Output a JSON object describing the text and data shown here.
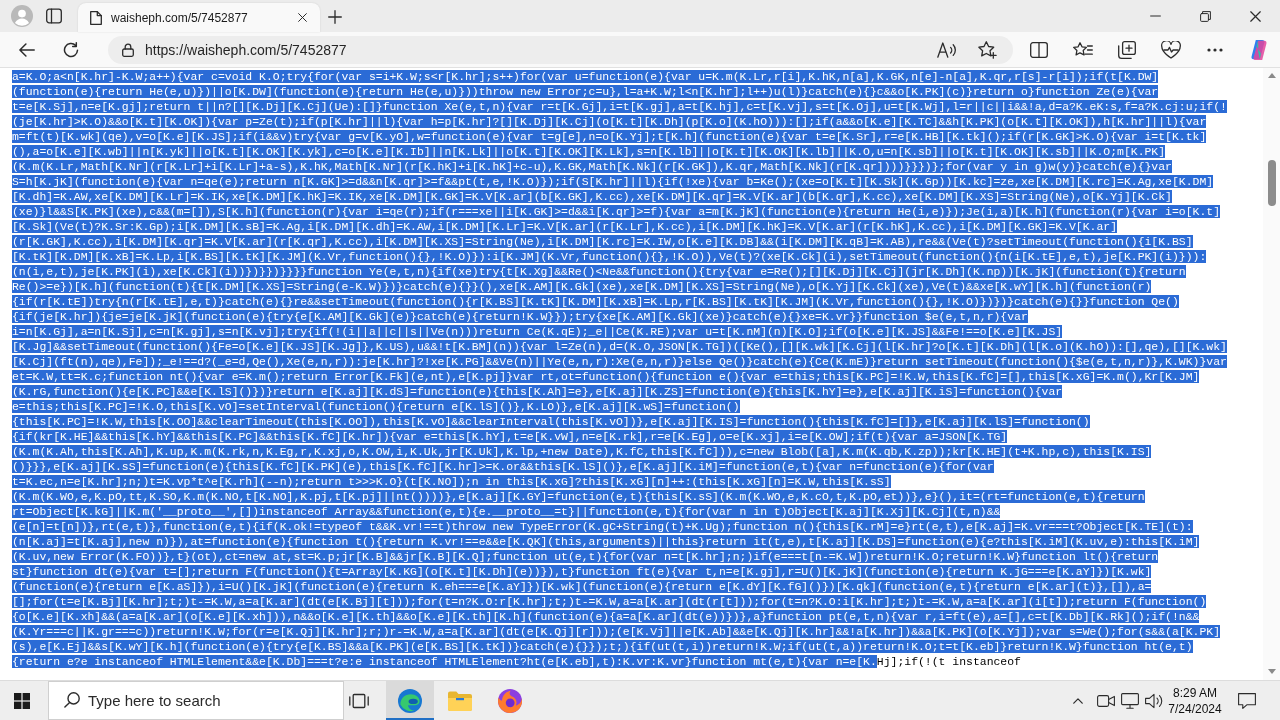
{
  "browser": {
    "tabs": [
      {
        "title": "waisheph.com/5/7452877",
        "selected": true
      }
    ],
    "address_bar": {
      "url": "https://waisheph.com/5/7452877"
    }
  },
  "page": {
    "lines": [
      {
        "text": "a=K.O;a<n[K.hr]-K.W;a++){var c=void K.O;try{for(var s=i+K.W;s<r[K.hr];s++)for(var u=function(e){var u=K.m(K.Lr,r[i],K.hK,n[a],K.GK,n[e]-n[a],K.qr,r[s]-r[i]);if(t[K.DW]",
        "selected": true
      },
      {
        "text": "(function(e){return He(e,u)})||o[K.DW](function(e){return He(e,u)}))throw new Error;c=u},l=a+K.W;l<n[K.hr];l++)u(l)}catch(e){}c&&o[K.PK](c)}return o}function Ze(e){var",
        "selected": true
      },
      {
        "text": "t=e[K.Sj],n=e[K.gj];return t||n?[][K.Dj][K.Cj](Ue):[]}function Xe(e,t,n){var r=t[K.Gj],i=t[K.gj],a=t[K.hj],c=t[K.vj],s=t[K.Oj],u=t[K.Wj],l=r||c||i&&!a,d=a?K.eK:s,f=a?K.cj:u;if(!",
        "selected": true
      },
      {
        "text": "(je[K.hr]>K.O)&&o[K.t][K.OK]){var p=Ze(t);if(p[K.hr]||l){var h=p[K.hr]?[][K.Dj][K.Cj](o[K.t][K.Dh](p[K.o](K.hO))):[];if(a&&o[K.e][K.TC]&&h[K.PK](o[K.t][K.OK]),h[K.hr]||l){var",
        "selected": true
      },
      {
        "text": "m=ft(t)[K.wk](qe),v=o[K.e][K.JS];if(i&&v)try{var g=v[K.yO],w=function(e){var t=g[e],n=o[K.Yj];t[K.h](function(e){var t=e[K.Sr],r=e[K.HB][K.tk]();if(r[K.GK]>K.O){var i=t[K.tk]",
        "selected": true
      },
      {
        "text": "(),a=o[K.e][K.wb]||n[K.yk]||o[K.t][K.OK][K.yk],c=o[K.e][K.Ib]||n[K.Lk]||o[K.t][K.OK][K.Lk],s=n[K.lb]||o[K.t][K.OK][K.lb]||K.O,u=n[K.sb]||o[K.t][K.OK][K.sb]||K.O;m[K.PK]",
        "selected": true
      },
      {
        "text": "(K.m(K.Lr,Math[K.Nr](r[K.Lr]+i[K.Lr]+a-s),K.hK,Math[K.Nr](r[K.hK]+i[K.hK]+c-u),K.GK,Math[K.Nk](r[K.GK]),K.qr,Math[K.Nk](r[K.qr])))}}})};for(var y in g)w(y)}catch(e){}var",
        "selected": true
      },
      {
        "text": "S=h[K.jK](function(e){var n=qe(e);return n[K.GK]>=d&&n[K.qr]>=f&&pt(t,e,!K.O)});if(S[K.hr]||l){if(!xe){var b=Ke();(xe=o[K.t][K.Sk](K.Gp))[K.kc]=ze,xe[K.DM][K.rc]=K.Ag,xe[K.DM]",
        "selected": true
      },
      {
        "text": "[K.dh]=K.AW,xe[K.DM][K.Lr]=K.IK,xe[K.DM][K.hK]=K.IK,xe[K.DM][K.GK]=K.V[K.ar](b[K.GK],K.cc),xe[K.DM][K.qr]=K.V[K.ar](b[K.qr],K.cc),xe[K.DM][K.XS]=String(Ne),o[K.Yj][K.Ck]",
        "selected": true
      },
      {
        "text": "(xe)}l&&S[K.PK](xe),c&&(m=[]),S[K.h](function(r){var i=qe(r);if(r===xe||i[K.GK]>=d&&i[K.qr]>=f){var a=m[K.jK](function(e){return He(i,e)});Je(i,a)[K.h](function(r){var i=o[K.t]",
        "selected": true
      },
      {
        "text": "[K.Sk](Ve(t)?K.Sr:K.Gp);i[K.DM][K.sB]=K.Ag,i[K.DM][K.dh]=K.AW,i[K.DM][K.Lr]=K.V[K.ar](r[K.Lr],K.cc),i[K.DM][K.hK]=K.V[K.ar](r[K.hK],K.cc),i[K.DM][K.GK]=K.V[K.ar]",
        "selected": true
      },
      {
        "text": "(r[K.GK],K.cc),i[K.DM][K.qr]=K.V[K.ar](r[K.qr],K.cc),i[K.DM][K.XS]=String(Ne),i[K.DM][K.rc]=K.IW,o[K.e][K.DB]&&(i[K.DM][K.qB]=K.AB),re&&(Ve(t)?setTimeout(function(){i[K.BS]",
        "selected": true
      },
      {
        "text": "[K.tK][K.DM][K.xB]=K.Lp,i[K.BS][K.tK][K.JM](K.Vr,function(){},!K.O)}):i[K.JM](K.Vr,function(){},!K.O)),Ve(t)?(xe[K.Ck](i),setTimeout(function(){n(i[K.tE],e,t),je[K.PK](i)})):",
        "selected": true
      },
      {
        "text": "(n(i,e,t),je[K.PK](i),xe[K.Ck](i))})}})}}}}function Ye(e,t,n){if(xe)try{t[K.Xg]&&Re()<Ne&&function(){try{var e=Re();[][K.Dj][K.Cj](jr[K.Dh](K.np))[K.jK](function(t){return",
        "selected": true
      },
      {
        "text": "Re()>=e})[K.h](function(t){t[K.DM][K.XS]=String(e-K.W)})}catch(e){}}(),xe[K.AM][K.Gk](xe),xe[K.DM][K.XS]=String(Ne),o[K.Yj][K.Ck](xe),Ve(t)&&xe[K.wY][K.h](function(r)",
        "selected": true
      },
      {
        "text": "{if(r[K.tE])try{n(r[K.tE],e,t)}catch(e){}re&&setTimeout(function(){r[K.BS][K.tK][K.DM][K.xB]=K.Lp,r[K.BS][K.tK][K.JM](K.Vr,function(){},!K.O)})})}catch(e){}}function Qe()",
        "selected": true
      },
      {
        "text": "{if(je[K.hr]){je=je[K.jK](function(e){try{e[K.AM][K.Gk](e)}catch(e){return!K.W}});try{xe[K.AM][K.Gk](xe)}catch(e){}xe=K.vr}}function $e(e,t,n,r){var",
        "selected": true
      },
      {
        "text": "i=n[K.Gj],a=n[K.Sj],c=n[K.gj],s=n[K.vj];try{if(!(i||a||c||s||Ve(n)))return Ce(K.qE);_e||Ce(K.RE);var u=t[K.nM](n)[K.O];if(o[K.e][K.JS]&&Fe!==o[K.e][K.JS]",
        "selected": true
      },
      {
        "text": "[K.Jg]&&setTimeout(function(){Fe=o[K.e][K.JS][K.Jg]},K.US),u&&!t[K.BM](n)){var l=Ze(n),d=(K.O,JSON[K.TG])([Ke(),[][K.wk][K.Cj](l[K.hr]?o[K.t][K.Dh](l[K.o](K.hO)):[],qe),[][K.wk]",
        "selected": true
      },
      {
        "text": "[K.Cj](ft(n),qe),Fe]);_e!==d?(_e=d,Qe(),Xe(e,n,r)):je[K.hr]?!xe[K.PG]&&Ve(n)||Ye(e,n,r):Xe(e,n,r)}else Qe()}catch(e){Ce(K.mE)}return setTimeout(function(){$e(e,t,n,r)},K.WK)}var",
        "selected": true
      },
      {
        "text": "et=K.W,tt=K.c;function nt(){var e=K.m();return Error[K.Fk](e,nt),e[K.pj]}var rt,ot=function(){function e(){var e=this;this[K.PC]=!K.W,this[K.fC]=[],this[K.xG]=K.m(),Kr[K.JM]",
        "selected": true
      },
      {
        "text": "(K.rG,function(){e[K.PC]&&e[K.lS]()})}return e[K.aj][K.dS]=function(e){this[K.Ah]=e},e[K.aj][K.ZS]=function(e){this[K.hY]=e},e[K.aj][K.iS]=function(){var",
        "selected": true
      },
      {
        "text": "e=this;this[K.PC]=!K.O,this[K.vO]=setInterval(function(){return e[K.lS]()},K.LO)},e[K.aj][K.wS]=function()",
        "selected": true
      },
      {
        "text": "{this[K.PC]=!K.W,this[K.OO]&&clearTimeout(this[K.OO]),this[K.vO]&&clearInterval(this[K.vO])},e[K.aj][K.IS]=function(){this[K.fC]=[]},e[K.aj][K.lS]=function()",
        "selected": true
      },
      {
        "text": "{if(kr[K.HE]&&this[K.hY]&&this[K.PC]&&this[K.fC][K.hr]){var e=this[K.hY],t=e[K.vW],n=e[K.rk],r=e[K.Eg],o=e[K.xj],i=e[K.OW];if(t){var a=JSON[K.TG]",
        "selected": true
      },
      {
        "text": "(K.m(K.Ah,this[K.Ah],K.up,K.m(K.rk,n,K.Eg,r,K.xj,o,K.OW,i,K.Uk,jr[K.Uk],K.lp,+new Date),K.fC,this[K.fC])),c=new Blob([a],K.m(K.qb,K.zp));kr[K.HE](t+K.hp,c),this[K.IS]",
        "selected": true
      },
      {
        "text": "()}}},e[K.aj][K.sS]=function(e){this[K.fC][K.PK](e),this[K.fC][K.hr]>=K.or&&this[K.lS]()},e[K.aj][K.iM]=function(e,t){var n=function(e){for(var",
        "selected": true
      },
      {
        "text": "t=K.ec,n=e[K.hr];n;)t=K.vp*t^e[K.rh](--n);return t>>>K.O}(t[K.NO]);n in this[K.xG]?this[K.xG][n]++:(this[K.xG][n]=K.W,this[K.sS]",
        "selected": true
      },
      {
        "text": "(K.m(K.WO,e,K.pO,tt,K.SO,K.m(K.NO,t[K.NO],K.pj,t[K.pj]||nt())))},e[K.aj][K.GY]=function(e,t){this[K.sS](K.m(K.WO,e,K.cO,t,K.pO,et))},e}(),it=(rt=function(e,t){return",
        "selected": true
      },
      {
        "text": "rt=Object[K.kG]||K.m('__proto__',[])instanceof Array&&function(e,t){e.__proto__=t}||function(e,t){for(var n in t)Object[K.aj][K.Xj][K.Cj](t,n)&&",
        "selected": true
      },
      {
        "text": "(e[n]=t[n])},rt(e,t)},function(e,t){if(K.ok!=typeof t&&K.vr!==t)throw new TypeError(K.gC+String(t)+K.Ug);function n(){this[K.rM]=e}rt(e,t),e[K.aj]=K.vr===t?Object[K.TE](t):",
        "selected": true
      },
      {
        "text": "(n[K.aj]=t[K.aj],new n)}),at=function(e){function t(){return K.vr!==e&&e[K.QK](this,arguments)||this}return it(t,e),t[K.aj][K.DS]=function(e){e?this[K.iM](K.uv,e):this[K.iM]",
        "selected": true
      },
      {
        "text": "(K.uv,new Error(K.FO))},t}(ot),ct=new at,st=K.p;jr[K.B]&&jr[K.B][K.Q];function ut(e,t){for(var n=t[K.hr];n;)if(e===t[n-=K.W])return!K.O;return!K.W}function lt(){return",
        "selected": true
      },
      {
        "text": "st}function dt(e){var t=[];return F(function(){t=Array[K.KG](o[K.t][K.Dh](e))}),t}function ft(e){var t,n=e[K.gj],r=U()[K.jK](function(e){return K.jG===e[K.aY]})[K.wk]",
        "selected": true
      },
      {
        "text": "(function(e){return e[K.aS]}),i=U()[K.jK](function(e){return K.eh===e[K.aY]})[K.wk](function(e){return e[K.dY][K.fG]()})[K.qk](function(e,t){return e[K.ar](t)},[]),a=",
        "selected": true
      },
      {
        "text": "[];for(t=e[K.Bj][K.hr];t;)t-=K.W,a=a[K.ar](dt(e[K.Bj][t]));for(t=n?K.O:r[K.hr];t;)t-=K.W,a=a[K.ar](dt(r[t]));for(t=n?K.O:i[K.hr];t;)t-=K.W,a=a[K.ar](i[t]);return F(function()",
        "selected": true
      },
      {
        "text": "{o[K.e][K.xh]&&(a=a[K.ar](o[K.e][K.xh])),n&&o[K.e][K.th]&&o[K.e][K.th][K.h](function(e){a=a[K.ar](dt(e))})},a}function pt(e,t,n){var r,i=ft(e),a=[],c=t[K.Db][K.Rk]();if(!n&&",
        "selected": true
      },
      {
        "text": "(K.Yr===c||K.gr===c))return!K.W;for(r=e[K.Qj][K.hr];r;)r-=K.W,a=a[K.ar](dt(e[K.Qj][r]));(e[K.Vj]||e[K.Ab]&&e[K.Qj][K.hr]&&!a[K.hr])&&a[K.PK](o[K.Yj]);var s=We();for(s&&(a[K.PK]",
        "selected": true
      },
      {
        "text": "(s),e[K.Ej]&&s[K.wY][K.h](function(e){try{e[K.BS]&&a[K.PK](e[K.BS][K.tK])}catch(e){}});t;){if(ut(t,i))return!K.W;if(ut(t,a))return!K.O;t=t[K.eb]}return!K.W}function ht(e,t)",
        "selected": true
      },
      {
        "segments": [
          {
            "text": "{return e?e instanceof HTMLElement&&e[K.Db]===t?e:e instanceof HTMLElement?ht(e[K.eb],t):K.vr:K.vr}function mt(e,t){var n=e[K.",
            "selected": true
          },
          {
            "text": "Hj];if(!(t instanceof",
            "selected": false
          }
        ]
      }
    ]
  },
  "taskbar": {
    "search": {
      "placeholder": "Type here to search"
    },
    "apps": [
      {
        "kind": "wave",
        "selected": true
      },
      {
        "kind": "folder",
        "selected": false
      },
      {
        "kind": "flame",
        "selected": false
      }
    ],
    "clock": {
      "time": "8:29 AM",
      "date": "7/24/2024"
    }
  }
}
